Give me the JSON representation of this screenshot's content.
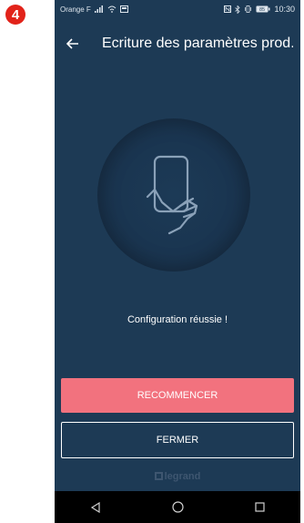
{
  "step_badge": "4",
  "status_bar": {
    "carrier": "Orange F",
    "time": "10:30",
    "battery": "85"
  },
  "header": {
    "title": "Ecriture des paramètres prod...",
    "back_icon": "arrow-left-icon"
  },
  "illustration": {
    "icon": "hand-holding-phone-icon"
  },
  "status_message": "Configuration réussie !",
  "buttons": {
    "restart_label": "RECOMMENCER",
    "close_label": "FERMER"
  },
  "brand": "legrand",
  "nav_bar": {
    "back_icon": "triangle-back-icon",
    "home_icon": "circle-home-icon",
    "recents_icon": "square-recents-icon"
  },
  "colors": {
    "background": "#1d3a55",
    "accent": "#f2727e",
    "badge": "#e2231a"
  }
}
